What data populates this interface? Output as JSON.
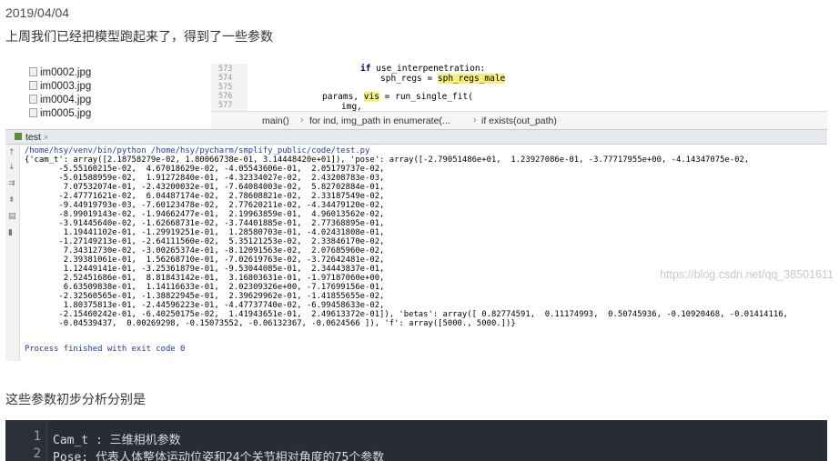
{
  "post": {
    "date": "2019/04/04",
    "intro": "上周我们已经把模型跑起来了，得到了一些参数",
    "analysis_heading": "这些参数初步分析分别是"
  },
  "ide": {
    "files": [
      "im0002.jpg",
      "im0003.jpg",
      "im0004.jpg",
      "im0005.jpg"
    ],
    "editor": {
      "line_numbers": [
        "573",
        "574",
        "575",
        "576",
        "577"
      ],
      "line1_kw": "if",
      "line1_rest": " use_interpenetration:",
      "line2_lhs": "sph_regs = ",
      "line2_val": "sph_regs_male",
      "line4_pre": "params, ",
      "line4_hl": "vis",
      "line4_post": " = run_single_fit(",
      "line5": "img,"
    },
    "breadcrumbs": [
      "main()",
      "for ind, img_path in enumerate(...",
      "if exists(out_path)"
    ],
    "run_tab": {
      "label": "test",
      "close": "×"
    },
    "console": {
      "command": "/home/hsy/venv/bin/python /home/hsy/pycharm/smplify_public/code/test.py",
      "output": [
        "{'cam_t': array([2.18758279e-02, 1.80066738e-01, 3.14448420e+01]), 'pose': array([-2.79051486e+01,  1.23927086e-01, -3.77717955e+00, -4.14347075e-02,",
        "       -5.55160215e-02,  4.67018629e-02, -4.05543606e-01,  2.05179737e-02,",
        "       -5.01588959e-02,  1.91272840e-01, -4.32334027e-02,  2.43208783e-03,",
        "        7.07532074e-01, -2.43200032e-01, -7.64084003e-02,  5.82702884e-01,",
        "       -2.47771621e-02,  6.04487174e-02,  2.78608821e-02,  2.33187549e-02,",
        "       -9.44919793e-03, -7.60123478e-02,  2.77620211e-02, -4.34479120e-02,",
        "       -8.99019143e-02, -1.94662477e-01,  2.19963859e-01,  4.96013562e-02,",
        "       -3.91445640e-02, -1.62668731e-02, -3.74401885e-01,  2.77368895e-01,",
        "        1.19441102e-01, -1.29919251e-01,  1.28580703e-01, -4.02431808e-01,",
        "       -1.27149213e-01, -2.64111560e-02,  5.35121253e-02,  2.33846170e-02,",
        "        7.34312730e-02, -3.00265374e-01, -8.12091563e-02,  2.07685960e-02,",
        "        2.39381061e-01,  1.56268710e-01, -7.02619763e-02, -3.72642481e-02,",
        "        1.12449141e-01, -3.25361879e-01, -9.53044085e-01,  2.34443837e-01,",
        "        2.52451686e-01,  8.81843142e-01,  3.16803631e-01, -1.97187060e+00,",
        "        6.63509838e-01,  1.14116633e-01,  2.02309326e+00, -7.17699156e-01,",
        "       -2.32560565e-01, -1.38822945e-01,  2.39629962e-01, -1.41855655e-02,",
        "        1.80375813e-01, -2.44596223e-01, -4.47737740e-02, -6.99458633e-02,",
        "       -2.15460242e-01, -6.40250175e-02,  1.41943651e-01,  2.49613372e-01]), 'betas': array([ 0.82774591,  0.11174993,  0.50745936, -0.10920468, -0.01414116,",
        "       -0.04539437,  0.00269298, -0.15073552, -0.06132367, -0.0624566 ]), 'f': array([5000., 5000.])}"
      ],
      "finished": "Process finished with exit code 0"
    },
    "watermark": "https://blog.csdn.net/qq_38501611"
  },
  "codeblock": {
    "lines": [
      {
        "num": "1",
        "text": "Cam_t : 三维相机参数"
      },
      {
        "num": "2",
        "text": "Pose: 代表人体整体运动位姿和24个关节相对角度的75个参数"
      }
    ]
  }
}
